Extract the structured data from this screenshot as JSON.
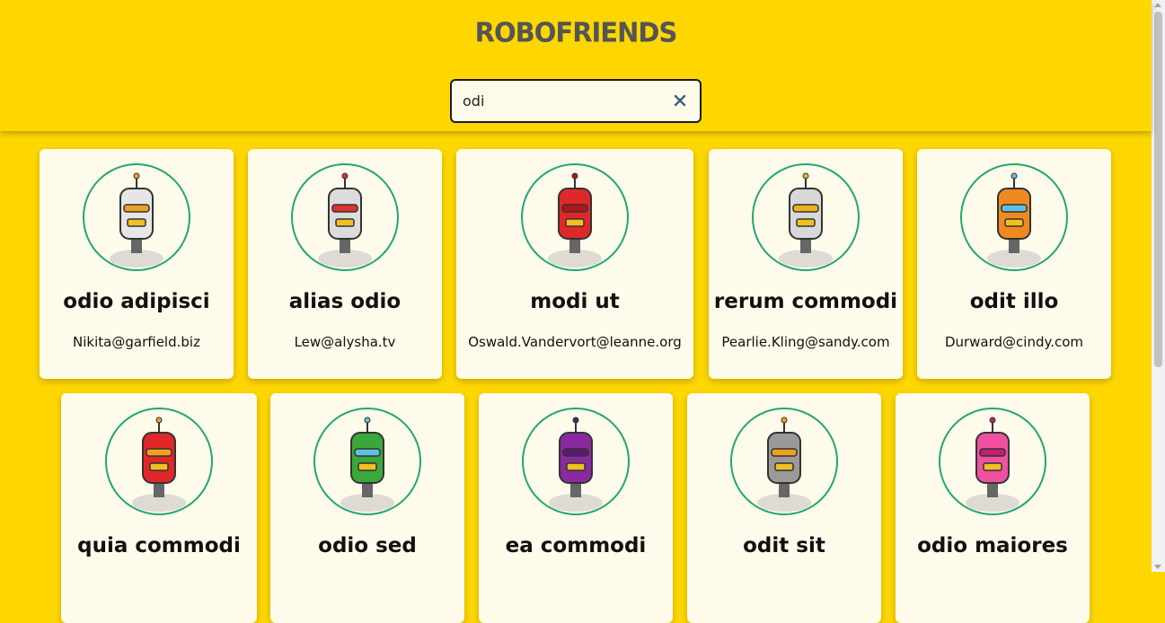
{
  "app": {
    "title": "ROBOFRIENDS"
  },
  "search": {
    "value": "odi",
    "clear_icon": "close-icon"
  },
  "colors": {
    "background": "#FFD700",
    "card": "#FFFBEA",
    "avatar_border": "#1fa774",
    "title": "#555555"
  },
  "robots": [
    {
      "name": "odio adipisci",
      "email": "Nikita@garfield.biz",
      "color": "#e6e6e6",
      "accent": "#f0a020"
    },
    {
      "name": "alias odio",
      "email": "Lew@alysha.tv",
      "color": "#dcdcdc",
      "accent": "#e03030"
    },
    {
      "name": "modi ut",
      "email": "Oswald.Vandervort@leanne.org",
      "color": "#e02828",
      "accent": "#b01818"
    },
    {
      "name": "rerum commodi",
      "email": "Pearlie.Kling@sandy.com",
      "color": "#d8d8d8",
      "accent": "#f0b020"
    },
    {
      "name": "odit illo",
      "email": "Durward@cindy.com",
      "color": "#f08a20",
      "accent": "#60c0e0"
    },
    {
      "name": "quia commodi",
      "email": "",
      "color": "#e02828",
      "accent": "#f0a020"
    },
    {
      "name": "odio sed",
      "email": "",
      "color": "#3aa83a",
      "accent": "#60c0e0"
    },
    {
      "name": "ea commodi",
      "email": "",
      "color": "#8a2aa0",
      "accent": "#5a1a70"
    },
    {
      "name": "odit sit",
      "email": "",
      "color": "#9a9a9a",
      "accent": "#f0a020"
    },
    {
      "name": "odio maiores",
      "email": "",
      "color": "#f050a0",
      "accent": "#c02070"
    }
  ]
}
